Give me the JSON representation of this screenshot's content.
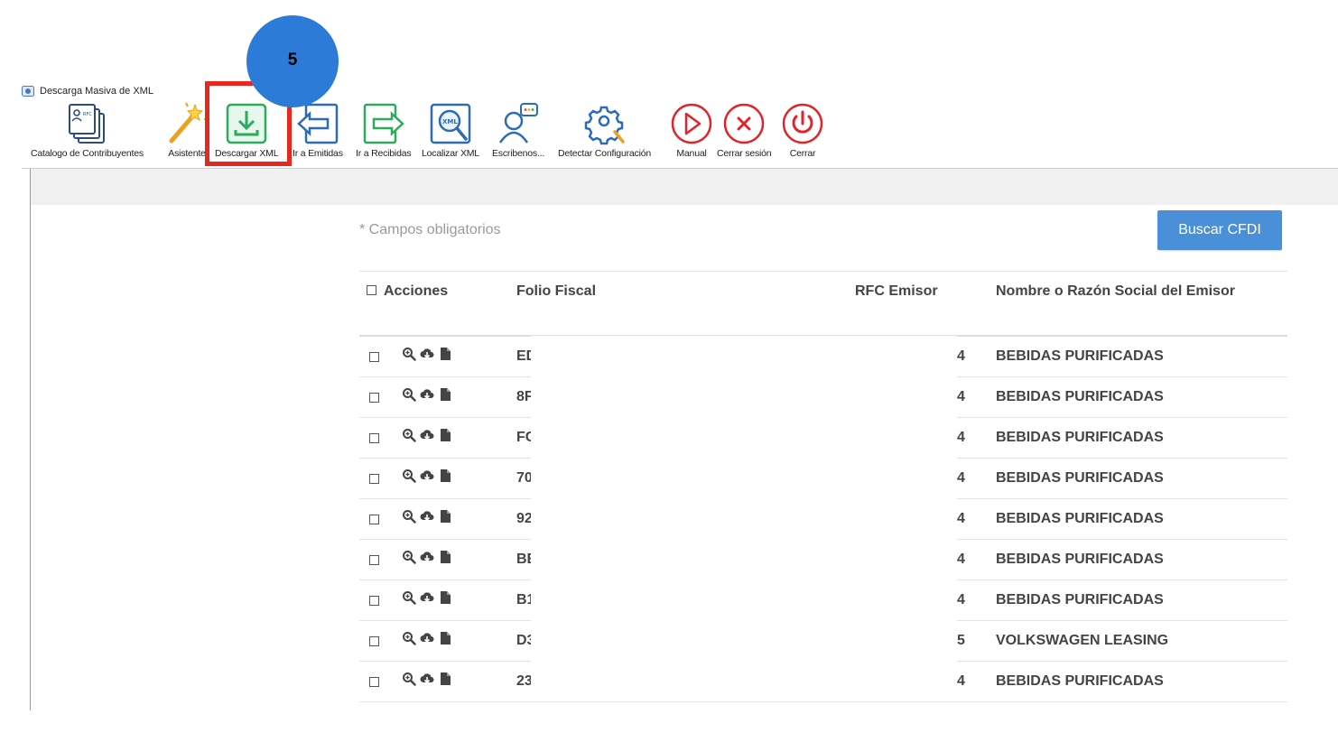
{
  "window": {
    "title": "Descarga Masiva de XML"
  },
  "toolbar": {
    "items": [
      {
        "name": "catalogo-button",
        "icon": "contributor-catalog-icon",
        "label": "Catalogo de Contribuyentes"
      },
      {
        "name": "asistente-button",
        "icon": "magic-wand-icon",
        "label": "Asistente"
      },
      {
        "name": "descargar-xml-button",
        "icon": "download-icon",
        "label": "Descargar XML"
      },
      {
        "name": "ir-emitidas-button",
        "icon": "arrow-left-icon",
        "label": "Ir a Emitidas"
      },
      {
        "name": "ir-recibidas-button",
        "icon": "arrow-right-icon",
        "label": "Ir a Recibidas"
      },
      {
        "name": "localizar-xml-button",
        "icon": "search-xml-icon",
        "label": "Localizar XML"
      },
      {
        "name": "escribenos-button",
        "icon": "chat-user-icon",
        "label": "Escribenos..."
      },
      {
        "name": "detectar-config-button",
        "icon": "gear-icon",
        "label": "Detectar Configuración"
      },
      {
        "name": "manual-button",
        "icon": "play-icon",
        "label": "Manual"
      },
      {
        "name": "cerrar-sesion-button",
        "icon": "close-circle-icon",
        "label": "Cerrar sesión"
      },
      {
        "name": "cerrar-button",
        "icon": "power-icon",
        "label": "Cerrar"
      }
    ]
  },
  "annotation": {
    "step": "5"
  },
  "form": {
    "required_note": "* Campos obligatorios",
    "search_button": "Buscar CFDI"
  },
  "table": {
    "headers": {
      "actions": "Acciones",
      "folio": "Folio Fiscal",
      "rfc": "RFC Emisor",
      "name": "Nombre o Razón Social del Emisor"
    },
    "rows": [
      {
        "folio": "ED",
        "rfc": "4",
        "name": "BEBIDAS PURIFICADAS"
      },
      {
        "folio": "8F",
        "rfc": "4",
        "name": "BEBIDAS PURIFICADAS"
      },
      {
        "folio": "FC",
        "rfc": "4",
        "name": "BEBIDAS PURIFICADAS"
      },
      {
        "folio": "70",
        "rfc": "4",
        "name": "BEBIDAS PURIFICADAS"
      },
      {
        "folio": "92",
        "rfc": "4",
        "name": "BEBIDAS PURIFICADAS"
      },
      {
        "folio": "BE",
        "rfc": "4",
        "name": "BEBIDAS PURIFICADAS"
      },
      {
        "folio": "B1",
        "rfc": "4",
        "name": "BEBIDAS PURIFICADAS"
      },
      {
        "folio": "D3",
        "rfc": "5",
        "name": "VOLKSWAGEN LEASING"
      },
      {
        "folio": "23",
        "rfc": "4",
        "name": "BEBIDAS PURIFICADAS"
      }
    ],
    "row_action_icons": [
      "zoom-icon",
      "cloud-download-icon",
      "file-icon"
    ]
  },
  "colors": {
    "accent_blue": "#4a90d9",
    "highlight_red": "#e8271f",
    "step_circle": "#2c7bd6"
  }
}
